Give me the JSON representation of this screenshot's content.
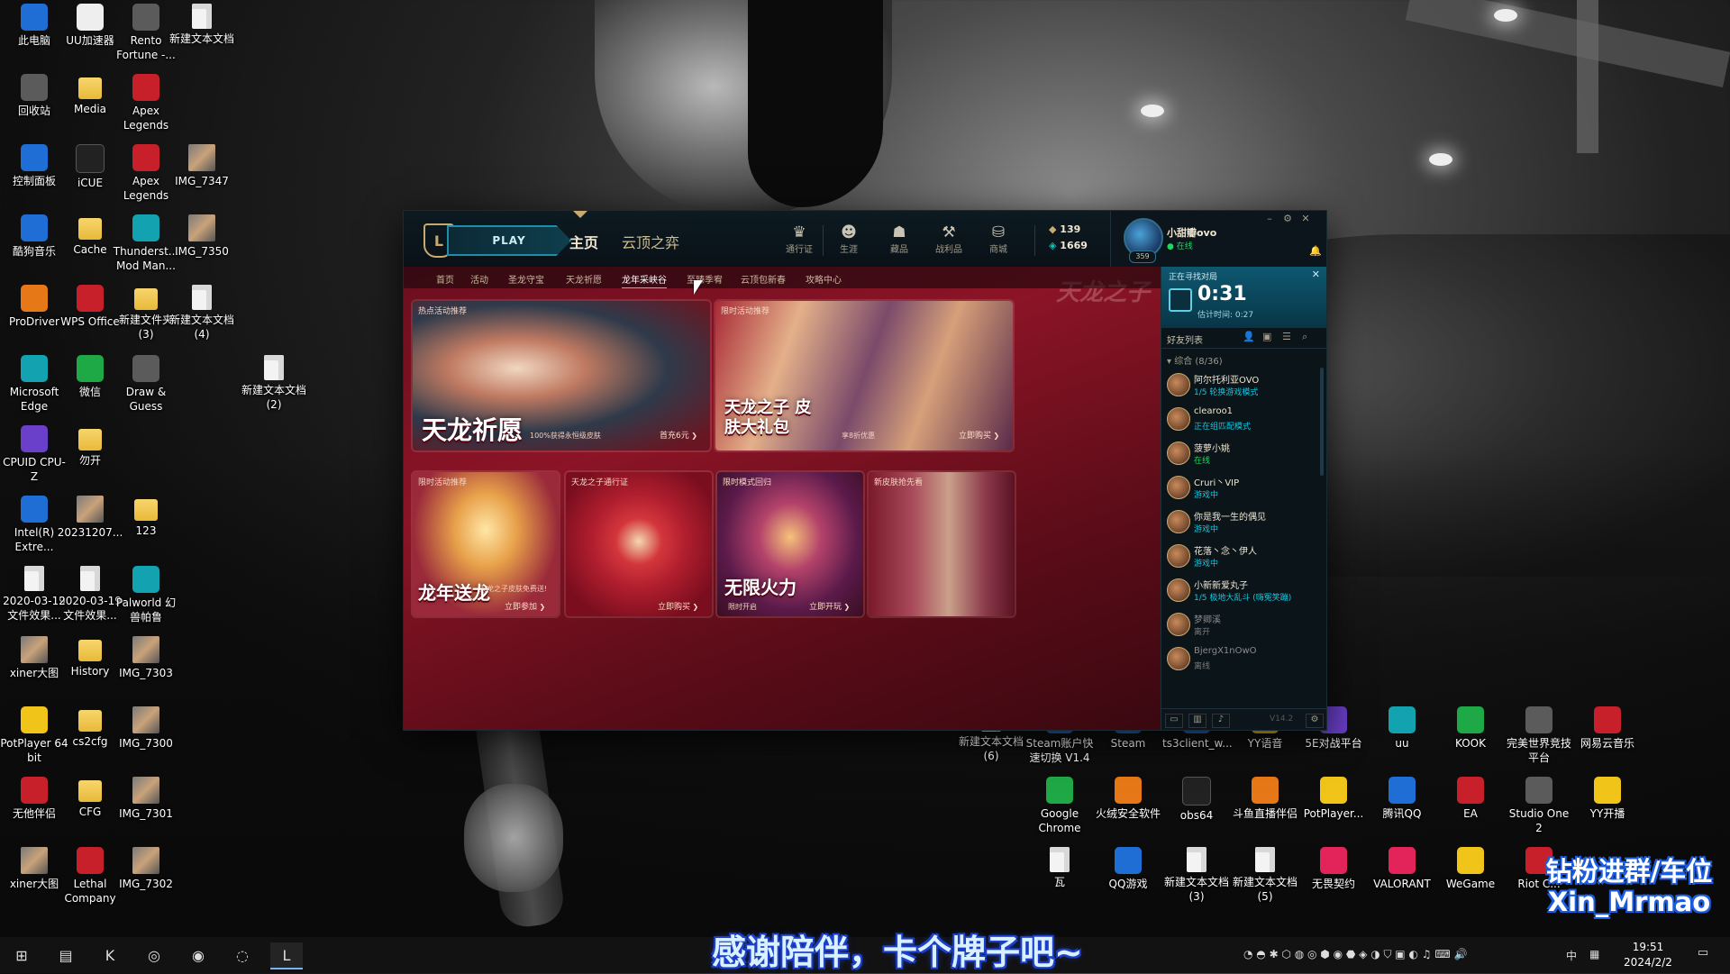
{
  "desktop_icons": [
    {
      "label": "此电脑",
      "icon": "computer-icon"
    },
    {
      "label": "UU加速器",
      "icon": "uu-accelerator-icon"
    },
    {
      "label": "Rento Fortune -...",
      "icon": "game-icon"
    },
    {
      "label": "新建文本文档",
      "icon": "text-file-icon"
    },
    {
      "label": "回收站",
      "icon": "recycle-bin-icon"
    },
    {
      "label": "Media",
      "icon": "folder-icon"
    },
    {
      "label": "Apex Legends",
      "icon": "apex-icon"
    },
    {
      "label": "控制面板",
      "icon": "control-panel-icon"
    },
    {
      "label": "iCUE",
      "icon": "icue-icon"
    },
    {
      "label": "Apex Legends",
      "icon": "apex-icon"
    },
    {
      "label": "IMG_7347",
      "icon": "image-icon"
    },
    {
      "label": "酷狗音乐",
      "icon": "kugou-icon"
    },
    {
      "label": "Cache",
      "icon": "folder-icon"
    },
    {
      "label": "Thunderst... Mod Man...",
      "icon": "thunderstore-icon"
    },
    {
      "label": "IMG_7350",
      "icon": "image-icon"
    },
    {
      "label": "ProDriver",
      "icon": "prodriver-icon"
    },
    {
      "label": "WPS Office",
      "icon": "wps-icon"
    },
    {
      "label": "新建文件夹 (3)",
      "icon": "folder-icon"
    },
    {
      "label": "新建文本文档 (4)",
      "icon": "text-file-icon"
    },
    {
      "label": "Microsoft Edge",
      "icon": "edge-icon"
    },
    {
      "label": "微信",
      "icon": "wechat-icon"
    },
    {
      "label": "Draw & Guess",
      "icon": "game-icon"
    },
    {
      "label": "新建文本文档 (2)",
      "icon": "text-file-icon"
    },
    {
      "label": "CPUID CPU-Z",
      "icon": "cpuz-icon"
    },
    {
      "label": "勿开",
      "icon": "folder-icon"
    },
    {
      "label": "Intel(R) Extre...",
      "icon": "intel-icon"
    },
    {
      "label": "20231207...",
      "icon": "image-icon"
    },
    {
      "label": "123",
      "icon": "folder-icon"
    },
    {
      "label": "2020-03-19 文件效果...",
      "icon": "text-file-icon"
    },
    {
      "label": "2020-03-19 文件效果...",
      "icon": "file-icon"
    },
    {
      "label": "Palworld 幻兽帕鲁",
      "icon": "palworld-icon"
    },
    {
      "label": "xiner大图",
      "icon": "image-icon"
    },
    {
      "label": "History",
      "icon": "folder-icon"
    },
    {
      "label": "IMG_7303",
      "icon": "image-icon"
    },
    {
      "label": "PotPlayer 64 bit",
      "icon": "potplayer-icon"
    },
    {
      "label": "cs2cfg",
      "icon": "folder-icon"
    },
    {
      "label": "IMG_7300",
      "icon": "image-icon"
    },
    {
      "label": "无他伴侣",
      "icon": "wuta-icon"
    },
    {
      "label": "CFG",
      "icon": "folder-icon"
    },
    {
      "label": "IMG_7301",
      "icon": "image-icon"
    },
    {
      "label": "xiner大图",
      "icon": "image-icon"
    },
    {
      "label": "Lethal Company",
      "icon": "lethal-company-icon"
    },
    {
      "label": "IMG_7302",
      "icon": "image-icon"
    },
    {
      "label": "新建文本文档 (6)",
      "icon": "text-file-icon"
    },
    {
      "label": "Steam账户快速切换 V1.4",
      "icon": "steam-switch-icon"
    },
    {
      "label": "Steam",
      "icon": "steam-icon"
    },
    {
      "label": "ts3client_w...",
      "icon": "teamspeak-icon"
    },
    {
      "label": "YY语音",
      "icon": "yy-icon"
    },
    {
      "label": "5E对战平台",
      "icon": "5e-icon"
    },
    {
      "label": "uu",
      "icon": "uu-icon"
    },
    {
      "label": "KOOK",
      "icon": "kook-icon"
    },
    {
      "label": "完美世界竞技平台",
      "icon": "perfect-world-icon"
    },
    {
      "label": "网易云音乐",
      "icon": "netease-music-icon"
    },
    {
      "label": "Google Chrome",
      "icon": "chrome-icon"
    },
    {
      "label": "火绒安全软件",
      "icon": "huorong-icon"
    },
    {
      "label": "obs64",
      "icon": "obs-icon"
    },
    {
      "label": "斗鱼直播伴侣",
      "icon": "douyu-icon"
    },
    {
      "label": "PotPlayer...",
      "icon": "potplayer-icon"
    },
    {
      "label": "腾讯QQ",
      "icon": "qq-icon"
    },
    {
      "label": "EA",
      "icon": "ea-icon"
    },
    {
      "label": "Studio One 2",
      "icon": "studio-one-icon"
    },
    {
      "label": "YY开播",
      "icon": "yy-live-icon"
    },
    {
      "label": "瓦",
      "icon": "text-file-icon"
    },
    {
      "label": "QQ游戏",
      "icon": "qq-game-icon"
    },
    {
      "label": "新建文本文档 (3)",
      "icon": "text-file-icon"
    },
    {
      "label": "新建文本文档 (5)",
      "icon": "text-file-icon"
    },
    {
      "label": "无畏契约",
      "icon": "valorant-cn-icon"
    },
    {
      "label": "VALORANT",
      "icon": "valorant-icon"
    },
    {
      "label": "WeGame",
      "icon": "wegame-icon"
    },
    {
      "label": "Riot C...",
      "icon": "riot-icon"
    }
  ],
  "client": {
    "play_label": "PLAY",
    "logo_glyph": "L",
    "main_tabs": [
      "主页",
      "云顶之弈"
    ],
    "top_nav": [
      {
        "label": "通行证",
        "icon": "pass-icon",
        "glyph": "♛"
      },
      {
        "label": "生涯",
        "icon": "profile-icon",
        "glyph": "☻"
      },
      {
        "label": "藏品",
        "icon": "collection-icon",
        "glyph": "☗"
      },
      {
        "label": "战利品",
        "icon": "loot-icon",
        "glyph": "⚒"
      },
      {
        "label": "商城",
        "icon": "store-icon",
        "glyph": "⛁"
      }
    ],
    "currency": {
      "rp": "139",
      "be": "1669",
      "plus": "+"
    },
    "profile": {
      "name": "小甜瓣ovo",
      "status": "在线",
      "level": "359"
    },
    "window_buttons": {
      "minimize": "–",
      "settings": "⚙",
      "close": "✕"
    },
    "sub_nav": [
      "首页",
      "活动",
      "圣龙守宝",
      "天龙祈愿",
      "龙年采峡谷",
      "至臻季宥",
      "云顶包新春",
      "攻略中心"
    ],
    "banner_logo": "天龙之子",
    "cards": [
      {
        "tag": "热点活动推荐",
        "title": "天龙祈愿",
        "sub": "100%获得永恒级皮肤",
        "cta": "首充6元"
      },
      {
        "tag": "限时活动推荐",
        "title": "天龙之子 皮肤大礼包",
        "sub": "享8折优惠",
        "cta": "立即购买"
      },
      {
        "tag": "限时活动推荐",
        "title": "龙年送龙",
        "sub": "天龙之子皮肤免费送!",
        "cta": "立即参加"
      },
      {
        "tag": "天龙之子通行证",
        "title": "",
        "sub": "",
        "cta": "立即购买"
      },
      {
        "tag": "限时模式回归",
        "title": "无限火力",
        "sub": "限时开启",
        "cta": "立即开玩"
      },
      {
        "tag": "新皮肤抢先看",
        "title": "",
        "sub": "",
        "cta": ""
      }
    ],
    "queue": {
      "title": "正在寻找对局",
      "time": "0:31",
      "estimate": "估计时间: 0:27",
      "close": "✕"
    },
    "friends_title": "好友列表",
    "group": "综合 (8/36)",
    "friends": [
      {
        "name": "阿尔托利亚OVO",
        "status": "1/5 轮换游戏模式",
        "state": "blue"
      },
      {
        "name": "clearoo1",
        "status": "正在组匹配模式",
        "state": "blue"
      },
      {
        "name": "菠萝小姚",
        "status": "在线",
        "state": "green"
      },
      {
        "name": "Cruri丶VIP",
        "status": "游戏中",
        "state": "blue"
      },
      {
        "name": "你是我一生的偶见",
        "status": "游戏中",
        "state": "blue"
      },
      {
        "name": "花落丶念丶伊人",
        "status": "游戏中",
        "state": "blue"
      },
      {
        "name": "小新新爱丸子",
        "status": "1/5 极地大乱斗 (嗨冤笑蹦)",
        "state": "blue"
      },
      {
        "name": "梦卿溪",
        "status": "离开",
        "state": "gray"
      },
      {
        "name": "BjergX1nOwO",
        "status": "离线",
        "state": "gray"
      }
    ],
    "version": "V14.2"
  },
  "taskbar": {
    "apps": [
      {
        "icon": "windows-start-icon",
        "glyph": "⊞"
      },
      {
        "icon": "file-explorer-icon",
        "glyph": "▤"
      },
      {
        "icon": "kook-taskbar-icon",
        "glyph": "K"
      },
      {
        "icon": "steam-taskbar-icon",
        "glyph": "◎"
      },
      {
        "icon": "browser-taskbar-icon",
        "glyph": "◉"
      },
      {
        "icon": "uu-taskbar-icon",
        "glyph": "◌"
      },
      {
        "icon": "league-taskbar-icon",
        "glyph": "L"
      }
    ],
    "tray_ime": "中",
    "time": "19:51",
    "date": "2024/2/2"
  },
  "overlay": {
    "subtitle": "感谢陪伴，卡个牌子吧~",
    "watermark_line1": "钻粉进群/车位",
    "watermark_line2": "Xin_Mrmao"
  }
}
